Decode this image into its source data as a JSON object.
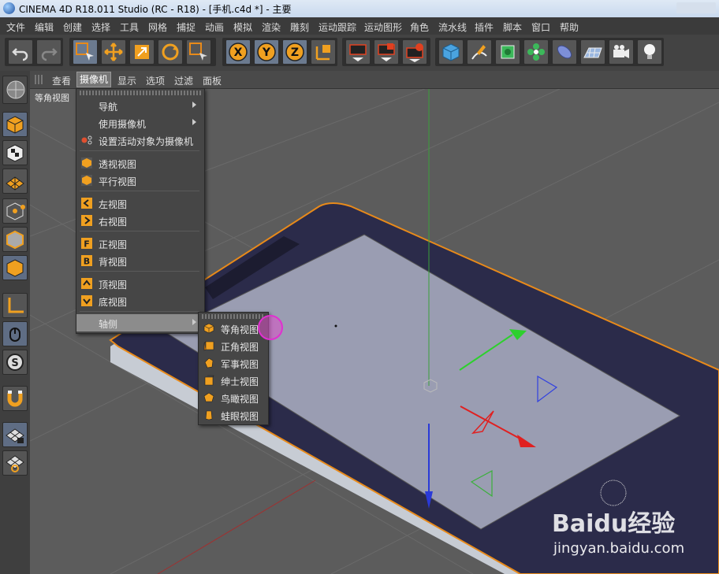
{
  "window": {
    "title": "CINEMA 4D R18.011 Studio (RC - R18) - [手机.c4d *] - 主要"
  },
  "menubar": [
    "文件",
    "编辑",
    "创建",
    "选择",
    "工具",
    "网格",
    "捕捉",
    "动画",
    "模拟",
    "渲染",
    "雕刻",
    "运动跟踪",
    "运动图形",
    "角色",
    "流水线",
    "插件",
    "脚本",
    "窗口",
    "帮助"
  ],
  "toolbar": {
    "icons": [
      "undo-icon",
      "redo-icon",
      "live-selection-icon",
      "move-icon",
      "scale-icon",
      "rotate-icon",
      "recent-tool-icon",
      "x-axis-icon",
      "y-axis-icon",
      "z-axis-icon",
      "coordinate-system-icon",
      "render-view-icon",
      "render-picture-viewer-icon",
      "render-settings-icon",
      "cube-icon",
      "pen-icon",
      "subdivision-icon",
      "cloner-icon",
      "deformer-icon",
      "floor-icon",
      "camera-icon",
      "light-icon"
    ],
    "axis_labels": [
      "X",
      "Y",
      "Z"
    ]
  },
  "viewport_menu": {
    "items": [
      "查看",
      "摄像机",
      "显示",
      "选项",
      "过滤",
      "面板"
    ],
    "active": "摄像机"
  },
  "viewport": {
    "label": "等角视图"
  },
  "camera_menu": {
    "items": [
      {
        "label": "导航",
        "submenu": true
      },
      {
        "label": "使用摄像机",
        "submenu": true
      },
      {
        "label": "设置活动对象为摄像机"
      },
      {
        "label": "透视视图"
      },
      {
        "label": "平行视图"
      },
      {
        "label": "左视图"
      },
      {
        "label": "右视图"
      },
      {
        "label": "正视图",
        "glyph": "F"
      },
      {
        "label": "背视图",
        "glyph": "B"
      },
      {
        "label": "顶视图"
      },
      {
        "label": "底视图"
      },
      {
        "label": "轴侧",
        "submenu": true
      }
    ]
  },
  "axonometric_submenu": {
    "items": [
      "等角视图",
      "正角视图",
      "军事视图",
      "绅士视图",
      "鸟瞰视图",
      "蛙眼视图"
    ]
  },
  "watermark": {
    "brand": "Baidu经验",
    "url": "jingyan.baidu.com"
  },
  "colors": {
    "accent_orange": "#e88a1a",
    "menu_bg": "#464646",
    "highlight": "#8c8c8c",
    "cursor": "#e030d0"
  }
}
